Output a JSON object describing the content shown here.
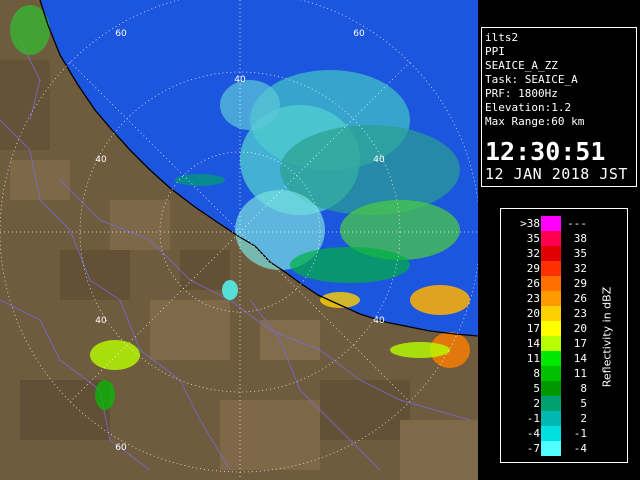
{
  "info_panel": {
    "lines": [
      "ilts2",
      "PPI",
      "SEAICE_A_ZZ",
      "Task: SEAICE_A",
      "PRF: 1800Hz",
      "Elevation:1.2",
      "Max Range:60 km"
    ],
    "time": "12:30:51",
    "date": "12 JAN 2018 JST"
  },
  "range_labels": [
    "60",
    "60",
    "40",
    "40",
    "40",
    "40",
    "40",
    "60"
  ],
  "legend": {
    "title": "Reflectivity in dBZ",
    "rows": [
      {
        "low": ">38",
        "high": "---",
        "color": "#ff00ff"
      },
      {
        "low": "35",
        "high": "38",
        "color": "#ff0050"
      },
      {
        "low": "32",
        "high": "35",
        "color": "#e00000"
      },
      {
        "low": "29",
        "high": "32",
        "color": "#ff3000"
      },
      {
        "low": "26",
        "high": "29",
        "color": "#ff7000"
      },
      {
        "low": "23",
        "high": "26",
        "color": "#ff9a00"
      },
      {
        "low": "20",
        "high": "23",
        "color": "#ffd000"
      },
      {
        "low": "17",
        "high": "20",
        "color": "#ffff00"
      },
      {
        "low": "14",
        "high": "17",
        "color": "#b8ff00"
      },
      {
        "low": "11",
        "high": "14",
        "color": "#00e800"
      },
      {
        "low": "8",
        "high": "11",
        "color": "#00c000"
      },
      {
        "low": "5",
        "high": "8",
        "color": "#009800"
      },
      {
        "low": "2",
        "high": "5",
        "color": "#00a070"
      },
      {
        "low": "-1",
        "high": "2",
        "color": "#00b8b0"
      },
      {
        "low": "-4",
        "high": "-1",
        "color": "#00e0e0"
      },
      {
        "low": "-7",
        "high": "-4",
        "color": "#50ffff"
      }
    ]
  },
  "colors": {
    "sea": "#1a5ae0",
    "land": "#6e5a3c",
    "rings": "#ffffff"
  }
}
